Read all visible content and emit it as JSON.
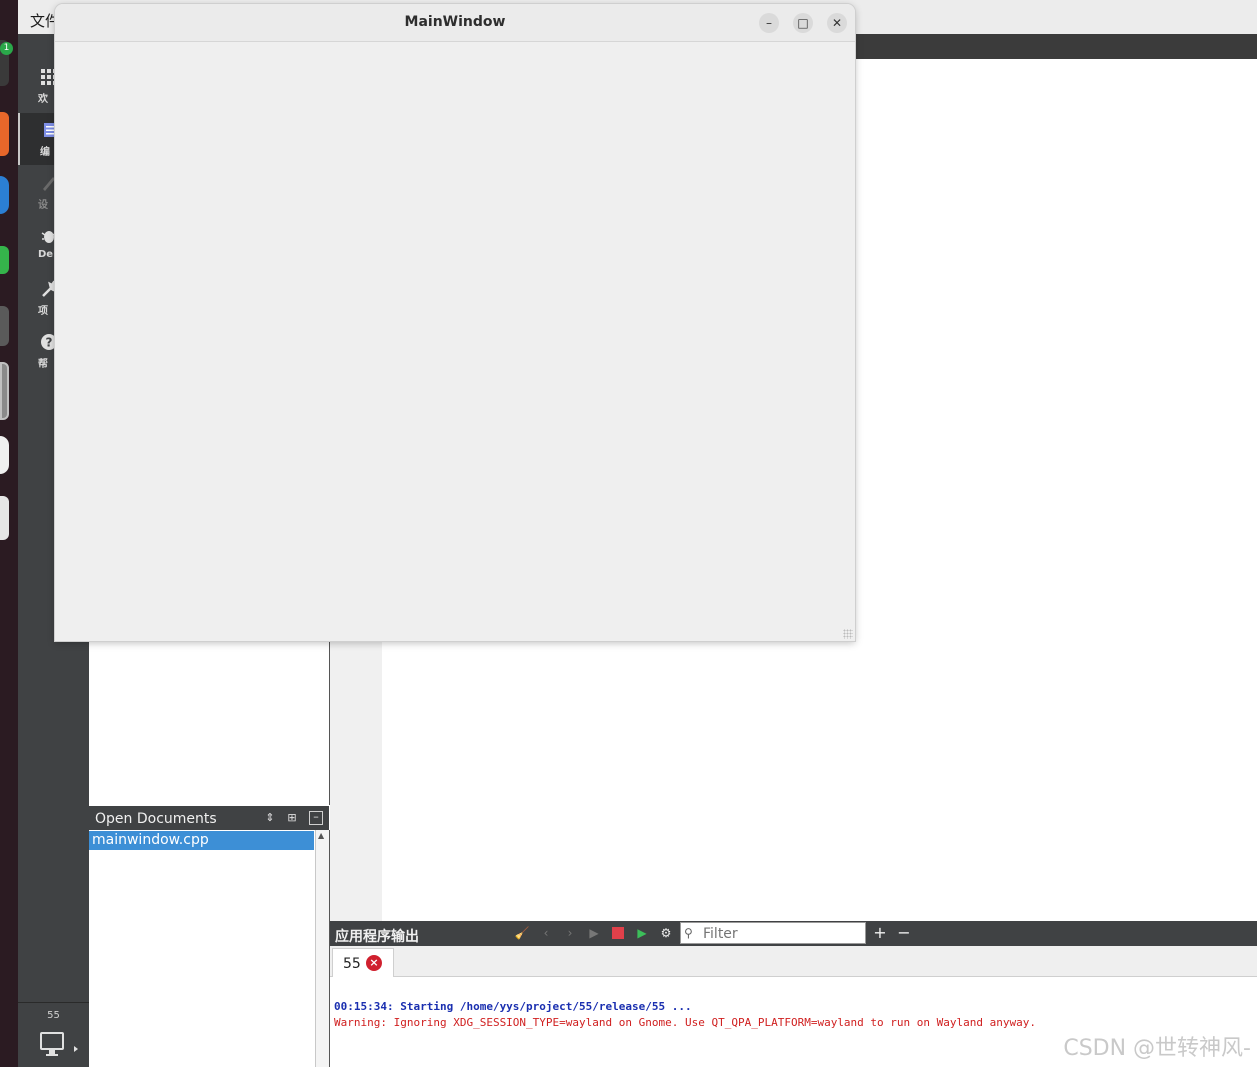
{
  "qtcreator": {
    "menu": {
      "file_label": "文件"
    },
    "modes": [
      {
        "label": "欢",
        "icon": "grid-icon"
      },
      {
        "label": "编",
        "icon": "edit-icon"
      },
      {
        "label": "设",
        "icon": "design-icon"
      },
      {
        "label": "Deb",
        "icon": "bug-icon"
      },
      {
        "label": "项",
        "icon": "wrench-icon"
      },
      {
        "label": "帮",
        "icon": "help-icon"
      }
    ],
    "kit": {
      "label": "55"
    }
  },
  "open_documents": {
    "title": "Open Documents",
    "items": [
      {
        "name": "mainwindow.cpp"
      }
    ]
  },
  "output": {
    "title": "应用程序输出",
    "filter_placeholder": "Filter",
    "tab_label": "55",
    "lines": [
      {
        "text": "00:15:34: Starting /home/yys/project/55/release/55 ...",
        "color": "#1a2fb0"
      },
      {
        "text": "Warning: Ignoring XDG_SESSION_TYPE=wayland on Gnome. Use QT_QPA_PLATFORM=wayland to run on Wayland anyway.",
        "color": "#d02020"
      }
    ]
  },
  "app_window": {
    "title": "MainWindow"
  },
  "dock": {
    "badge": "1"
  },
  "watermark": "CSDN @世转神风-"
}
